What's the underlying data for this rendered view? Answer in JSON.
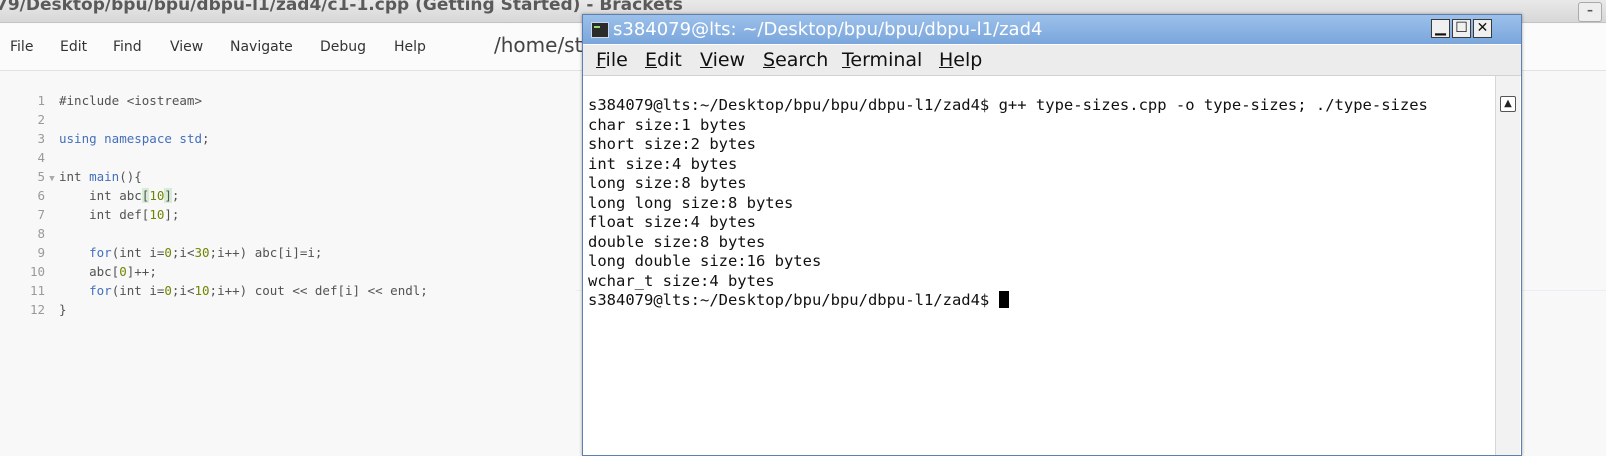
{
  "brackets": {
    "title": "79/Desktop/bpu/bpu/dbpu-l1/zad4/c1-1.cpp (Getting Started) - Brackets",
    "menu": [
      "File",
      "Edit",
      "Find",
      "View",
      "Navigate",
      "Debug",
      "Help"
    ],
    "path": "/home/st",
    "line_numbers": [
      "1",
      "2",
      "3",
      "4",
      "5",
      "6",
      "7",
      "8",
      "9",
      "10",
      "11",
      "12"
    ],
    "code": {
      "l1": "#include <iostream>",
      "l3a": "using namespace ",
      "l3b": "std",
      "l3c": ";",
      "l5a": "int ",
      "l5b": "main",
      "l5c": "(){",
      "l6a": "    int abc",
      "l6b": "[",
      "l6c": "10",
      "l6d": "]",
      "l6e": ";",
      "l7a": "    int def[",
      "l7b": "10",
      "l7c": "];",
      "l9a": "    ",
      "l9b": "for",
      "l9c": "(int i=",
      "l9d": "0",
      "l9e": ";i<",
      "l9f": "30",
      "l9g": ";i++) abc[i]=i;",
      "l10a": "    abc[",
      "l10b": "0",
      "l10c": "]++;",
      "l11a": "    ",
      "l11b": "for",
      "l11c": "(int i=",
      "l11d": "0",
      "l11e": ";i<",
      "l11f": "10",
      "l11g": ";i++) cout << def[i] << endl;",
      "l12": "}"
    }
  },
  "terminal": {
    "title": "s384079@lts: ~/Desktop/bpu/bpu/dbpu-l1/zad4",
    "menu": [
      "File",
      "Edit",
      "View",
      "Search",
      "Terminal",
      "Help"
    ],
    "lines": [
      "s384079@lts:~/Desktop/bpu/bpu/dbpu-l1/zad4$ g++ type-sizes.cpp -o type-sizes; ./type-sizes",
      "char size:1 bytes",
      "short size:2 bytes",
      "int size:4 bytes",
      "long size:8 bytes",
      "long long size:8 bytes",
      "float size:4 bytes",
      "double size:8 bytes",
      "long double size:16 bytes",
      "wchar_t size:4 bytes"
    ],
    "prompt": "s384079@lts:~/Desktop/bpu/bpu/dbpu-l1/zad4$ "
  }
}
